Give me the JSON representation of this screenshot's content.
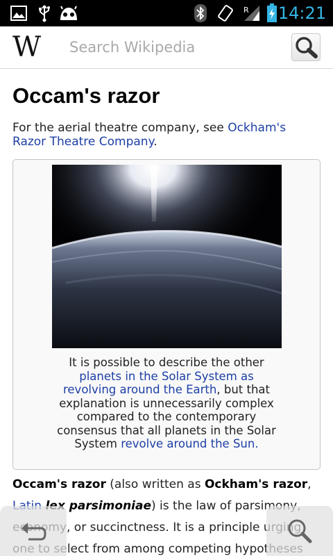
{
  "status_bar": {
    "time": "14:21",
    "icons": [
      "gallery-icon",
      "usb-icon",
      "android-icon",
      "bluetooth-icon",
      "rotate-icon",
      "signal-icon",
      "battery-charging-icon"
    ],
    "signal_roaming": "R",
    "accent": "#35b5e5"
  },
  "header": {
    "logo": "W",
    "search_placeholder": "Search Wikipedia",
    "search_button_icon": "magnifier-icon"
  },
  "article": {
    "title": "Occam's razor",
    "hatnote": {
      "prefix": "For the aerial theatre company, see ",
      "link": "Ockham's Razor Theatre Company",
      "suffix": "."
    },
    "infobox": {
      "image_icon": "earth-sunrise-image",
      "caption_1": "It is possible to describe the other ",
      "caption_link_1": "planets in the Solar System as revolving around the Earth",
      "caption_2": ", but that explanation is unnecessarily complex compared to the contemporary consensus that all planets in the Solar System ",
      "caption_link_2": "revolve around the Sun."
    },
    "paragraph": {
      "bold_1": "Occam's razor",
      "text_1": " (also written as ",
      "bold_2": "Ockham's razor",
      "text_2": ", ",
      "link_latin": "Latin",
      "text_3": " ",
      "italic": "lex parsimoniae",
      "text_4": ") is the law of parsimony, economy, or succinctness. It is a principle urging one to select from among competing hypotheses"
    }
  },
  "nav": {
    "back_icon": "back-arrow-icon",
    "search_icon": "search-icon"
  },
  "colors": {
    "link": "#1d3fa6",
    "infobox_bg": "#f9f9f9",
    "infobox_border": "#c4c4c4"
  }
}
